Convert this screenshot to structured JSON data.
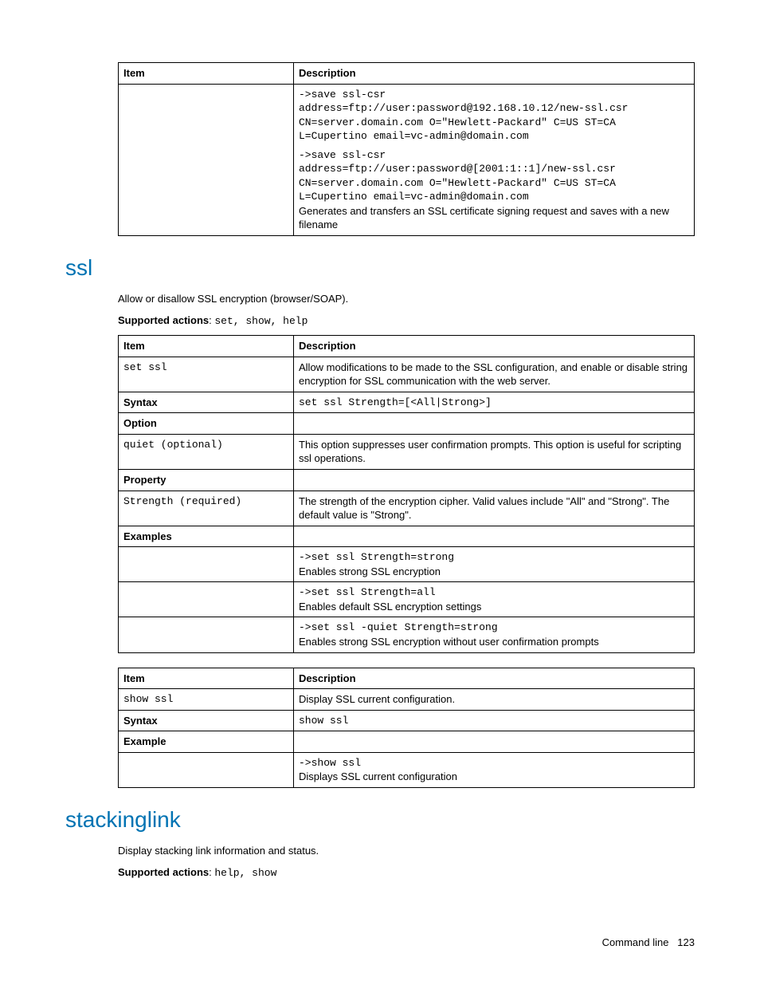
{
  "table1": {
    "headers": [
      "Item",
      "Description"
    ],
    "row": {
      "ex1_line1": "->save ssl-csr",
      "ex1_line2": "address=ftp://user:password@192.168.10.12/new-ssl.csr",
      "ex1_line3": "CN=server.domain.com O=\"Hewlett-Packard\" C=US ST=CA",
      "ex1_line4": "L=Cupertino email=vc-admin@domain.com",
      "ex2_line1": "->save ssl-csr",
      "ex2_line2": "address=ftp://user:password@[2001:1::1]/new-ssl.csr",
      "ex2_line3": "CN=server.domain.com O=\"Hewlett-Packard\" C=US ST=CA",
      "ex2_line4": "L=Cupertino email=vc-admin@domain.com",
      "ex2_desc": "Generates and transfers an SSL certificate signing request and saves with a new filename"
    }
  },
  "ssl": {
    "heading": "ssl",
    "intro": "Allow or disallow SSL encryption (browser/SOAP).",
    "actions_label": "Supported actions",
    "actions_value": "set, show, help",
    "table_set": {
      "headers": [
        "Item",
        "Description"
      ],
      "set_cmd": "set ssl",
      "set_desc": "Allow modifications to be made to the SSL configuration, and enable or disable string encryption for SSL communication with the web server.",
      "syntax_label": "Syntax",
      "syntax_value": "set ssl Strength=[<All|Strong>]",
      "option_label": "Option",
      "quiet_name": "quiet (optional)",
      "quiet_desc": "This option suppresses user confirmation prompts. This option is useful for scripting ssl operations.",
      "property_label": "Property",
      "strength_name": "Strength (required)",
      "strength_desc": "The strength of the encryption cipher. Valid values include \"All\" and \"Strong\". The default value is \"Strong\".",
      "examples_label": "Examples",
      "ex1_cmd": "->set ssl Strength=strong",
      "ex1_desc": "Enables strong SSL encryption",
      "ex2_cmd": "->set ssl Strength=all",
      "ex2_desc": "Enables default SSL encryption settings",
      "ex3_cmd": "->set ssl -quiet Strength=strong",
      "ex3_desc": "Enables strong SSL encryption without user confirmation prompts"
    },
    "table_show": {
      "headers": [
        "Item",
        "Description"
      ],
      "show_cmd": "show ssl",
      "show_desc": "Display SSL current configuration.",
      "syntax_label": "Syntax",
      "syntax_value": "show ssl",
      "example_label": "Example",
      "ex_cmd": "->show ssl",
      "ex_desc": "Displays SSL current configuration"
    }
  },
  "stackinglink": {
    "heading": "stackinglink",
    "intro": "Display stacking link information and status.",
    "actions_label": "Supported actions",
    "actions_value": "help, show"
  },
  "footer": {
    "label": "Command line",
    "page": "123"
  }
}
